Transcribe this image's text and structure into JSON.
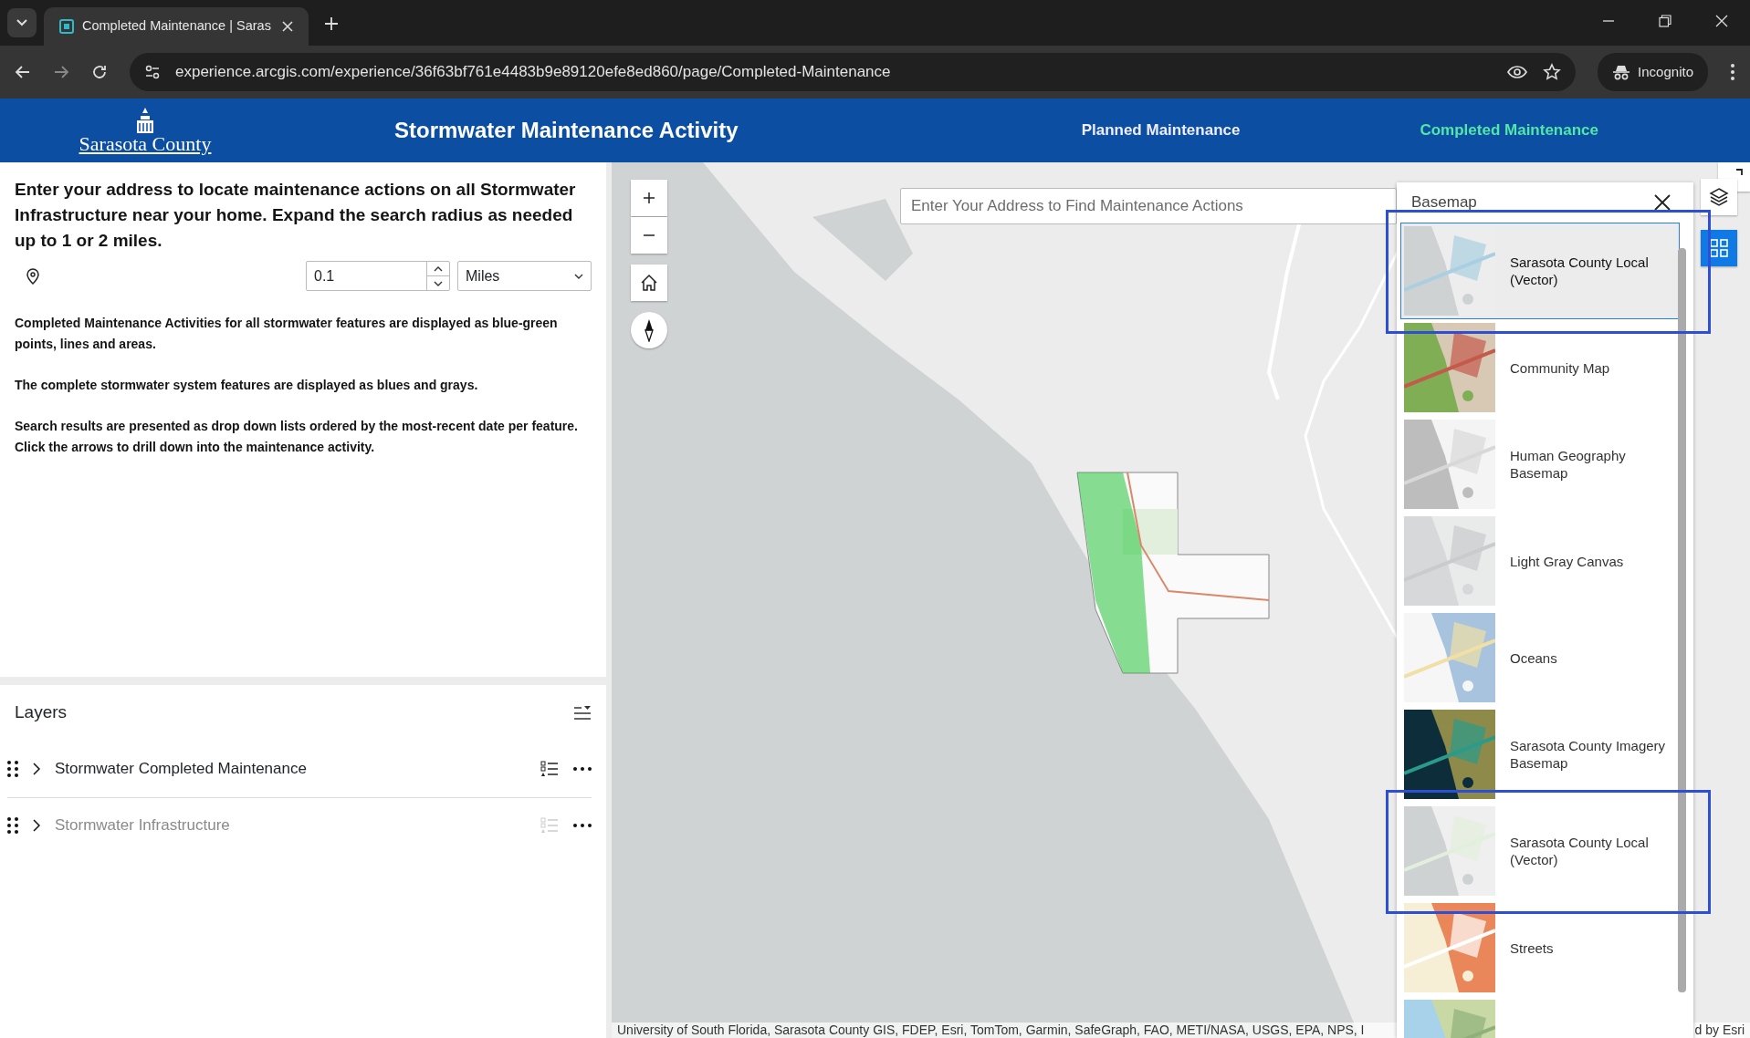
{
  "browser": {
    "tab_title": "Completed Maintenance | Saras",
    "url": "experience.arcgis.com/experience/36f63bf761e4483b9e89120efe8ed860/page/Completed-Maintenance",
    "profile": "Incognito"
  },
  "header": {
    "logo_text": "Sarasota County",
    "title": "Stormwater Maintenance Activity",
    "nav": [
      {
        "label": "Planned Maintenance",
        "selected": false
      },
      {
        "label": "Completed Maintenance",
        "selected": true
      }
    ]
  },
  "search_panel": {
    "intro": "Enter your address to locate maintenance actions on all Stormwater Infrastructure near your home.  Expand the search radius as needed up to 1 or 2 miles.",
    "radius": "0.1",
    "unit": "Miles",
    "notes": [
      "Completed Maintenance Activities for all stormwater features are displayed as blue-green points, lines and areas.",
      "The complete stormwater system features are displayed as blues and grays.",
      "Search results are presented as drop down lists ordered by the most-recent date per feature. Click the arrows to drill down into the maintenance activity."
    ]
  },
  "layers": {
    "title": "Layers",
    "items": [
      {
        "name": "Stormwater Completed Maintenance",
        "visible": true
      },
      {
        "name": "Stormwater Infrastructure",
        "visible": false
      }
    ]
  },
  "map": {
    "search": {
      "placeholder": "Enter Your Address to Find Maintenance Actions"
    },
    "attribution": "University of South Florida, Sarasota County GIS, FDEP, Esri, TomTom, Garmin, SafeGraph, FAO, METI/NASA, USGS, EPA, NPS, I",
    "attribution_end": "d by Esri",
    "basemap_panel": {
      "title": "Basemap",
      "items": [
        {
          "kind": "basemap",
          "label": "Sarasota County Local (Vector)",
          "selected": true,
          "highlighted": true
        },
        {
          "kind": "basemap",
          "label": "Community Map",
          "selected": false,
          "highlighted": false
        },
        {
          "kind": "basemap",
          "label": "Human Geography Basemap",
          "selected": false,
          "highlighted": false
        },
        {
          "kind": "basemap",
          "label": "Light Gray Canvas",
          "selected": false,
          "highlighted": false
        },
        {
          "kind": "basemap",
          "label": "Oceans",
          "selected": false,
          "highlighted": false
        },
        {
          "kind": "basemap",
          "label": "Sarasota County Imagery Basemap",
          "selected": false,
          "highlighted": false
        },
        {
          "kind": "basemap",
          "label": "Sarasota County Local (Vector)",
          "selected": false,
          "highlighted": true
        },
        {
          "kind": "basemap",
          "label": "Streets",
          "selected": false,
          "highlighted": false
        },
        {
          "kind": "picture"
        }
      ]
    }
  }
}
